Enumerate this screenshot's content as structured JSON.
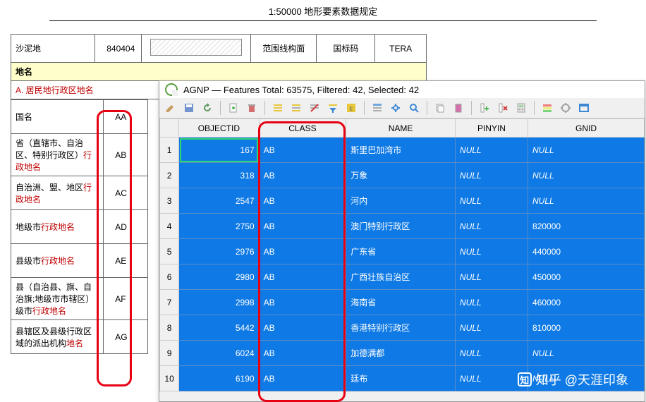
{
  "doc": {
    "title": "1:50000 地形要素数据规定",
    "row_sandy": {
      "name": "沙泥地",
      "code": "840404",
      "col3": "",
      "col4": "范围线构面",
      "col5": "国标码",
      "col6": "TERA"
    },
    "section_name": "地名",
    "subsection": "A. 居民地行政区地名",
    "rows": [
      {
        "desc_pre": "国名",
        "desc_red": "",
        "code": "AA"
      },
      {
        "desc_pre": "省（直辖市、自治区、特别行政区）",
        "desc_red": "行政地名",
        "code": "AB"
      },
      {
        "desc_pre": "自治洲、盟、地区",
        "desc_red": "行政地名",
        "code": "AC"
      },
      {
        "desc_pre": "地级市",
        "desc_red": "行政地名",
        "code": "AD"
      },
      {
        "desc_pre": "县级市",
        "desc_red": "行政地名",
        "code": "AE"
      },
      {
        "desc_pre": "县（自治县、旗、自治旗;地级市市辖区）级市",
        "desc_red": "行政地名",
        "code": "AF"
      },
      {
        "desc_pre": "县辖区及县级行政区域的派出机构",
        "desc_red": "地名",
        "code": "AG"
      }
    ]
  },
  "qgis": {
    "title": "AGNP — Features Total: 63575, Filtered: 42, Selected: 42",
    "headers": {
      "obj": "OBJECTID",
      "class": "CLASS",
      "name": "NAME",
      "pinyin": "PINYIN",
      "gnid": "GNID"
    },
    "rows": [
      {
        "n": "1",
        "obj": "167",
        "class": "AB",
        "name": "斯里巴加湾市",
        "pin": "NULL",
        "gnid": "NULL"
      },
      {
        "n": "2",
        "obj": "318",
        "class": "AB",
        "name": "万象",
        "pin": "NULL",
        "gnid": "NULL"
      },
      {
        "n": "3",
        "obj": "2547",
        "class": "AB",
        "name": "河内",
        "pin": "NULL",
        "gnid": "NULL"
      },
      {
        "n": "4",
        "obj": "2750",
        "class": "AB",
        "name": "澳门特别行政区",
        "pin": "NULL",
        "gnid": "820000"
      },
      {
        "n": "5",
        "obj": "2976",
        "class": "AB",
        "name": "广东省",
        "pin": "NULL",
        "gnid": "440000"
      },
      {
        "n": "6",
        "obj": "2980",
        "class": "AB",
        "name": "广西壮族自治区",
        "pin": "NULL",
        "gnid": "450000"
      },
      {
        "n": "7",
        "obj": "2998",
        "class": "AB",
        "name": "海南省",
        "pin": "NULL",
        "gnid": "460000"
      },
      {
        "n": "8",
        "obj": "5442",
        "class": "AB",
        "name": "香港特别行政区",
        "pin": "NULL",
        "gnid": "810000"
      },
      {
        "n": "9",
        "obj": "6024",
        "class": "AB",
        "name": "加德满都",
        "pin": "NULL",
        "gnid": "NULL"
      },
      {
        "n": "10",
        "obj": "6190",
        "class": "AB",
        "name": "廷布",
        "pin": "NULL",
        "gnid": "NULL"
      }
    ]
  },
  "watermark": "知乎 @天涯印象"
}
